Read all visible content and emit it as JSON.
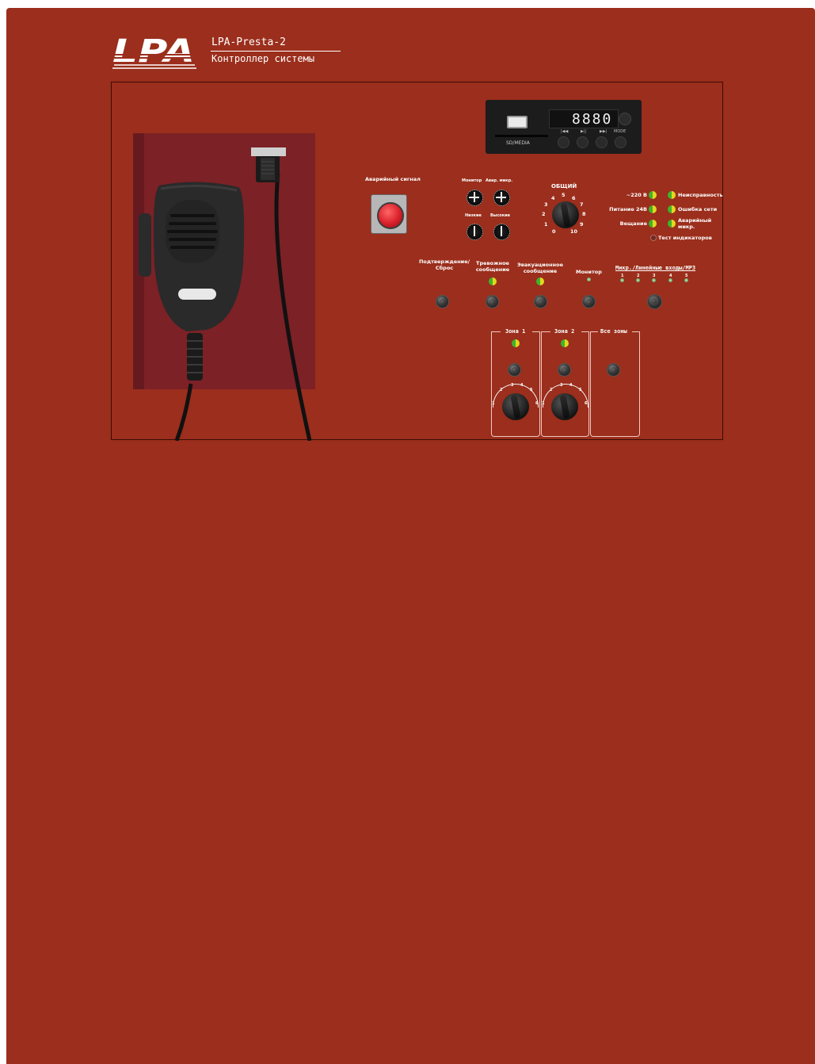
{
  "brand": {
    "logo": "LPA",
    "model": "LPA-Presta-2",
    "subtitle": "Контроллер системы"
  },
  "media_player": {
    "display": "8880",
    "slot_label": "SD/MEDIA",
    "keys": [
      "|◀◀",
      "▶||",
      "▶▶|",
      "MODE"
    ]
  },
  "emergency": {
    "label": "Аварийный сигнал"
  },
  "pots": {
    "monitor": "Монитор",
    "emergency_mic": "Авар. микр.",
    "low": "Низкие",
    "high": "Высокие"
  },
  "master": {
    "label": "ОБЩИЙ",
    "scale": [
      "0",
      "1",
      "2",
      "3",
      "4",
      "5",
      "6",
      "7",
      "8",
      "9",
      "10"
    ]
  },
  "indicators": {
    "left": [
      "~220 В",
      "Питание 24В",
      "Вещание"
    ],
    "right": [
      "Неисправность",
      "Ошибка сети",
      "Аварийный микр."
    ],
    "test_label": "Тест индикаторов"
  },
  "controls": {
    "confirm_reset": "Подтверждение/ Сброс",
    "alarm_message": "Тревожное сообщение",
    "evac_message": "Эвакуационное сообщение",
    "monitor": "Монитор",
    "inputs": "Микр./Линейные входы/MP3",
    "input_numbers": [
      "1",
      "2",
      "3",
      "4",
      "5"
    ]
  },
  "zones": [
    {
      "label": "Зона 1"
    },
    {
      "label": "Зона 2"
    },
    {
      "label": "Все зоны"
    }
  ],
  "zone_scale": [
    "1",
    "2",
    "3",
    "4",
    "5",
    "6"
  ],
  "colors": {
    "housing": "#9b2e1c",
    "led_green": "#3fb22f",
    "led_yellow": "#e3d81c",
    "emergency_button": "#d9202a"
  }
}
